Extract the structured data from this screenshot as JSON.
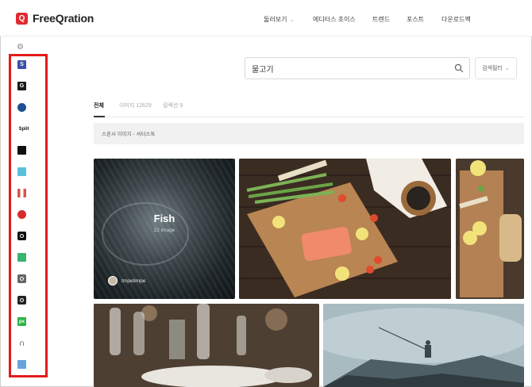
{
  "app": {
    "logo_mark": "Q",
    "name": "FreeQration"
  },
  "nav": {
    "items": [
      {
        "label": "둘러보기",
        "has_chevron": true
      },
      {
        "label": "에디터스 초이스"
      },
      {
        "label": "트렌드"
      },
      {
        "label": "포스트"
      },
      {
        "label": "다운로드팩"
      }
    ],
    "chevron": "⌄"
  },
  "sidebar": {
    "gear_icon": "gear-icon",
    "items": [
      {
        "icon": "shutterstock-icon",
        "glyph": "S",
        "color": "#3c4fa8"
      },
      {
        "icon": "getty-icon",
        "glyph": "G",
        "color": "#1a1a1a"
      },
      {
        "icon": "circle-logo-icon",
        "glyph": "●",
        "color": "#1d4f91"
      },
      {
        "icon": "split-icon",
        "glyph": "Split",
        "color": "#ffffff"
      },
      {
        "icon": "black-square-icon",
        "glyph": "▪",
        "color": "#111111"
      },
      {
        "icon": "cloud-icon",
        "glyph": "☁",
        "color": "#5bc0de"
      },
      {
        "icon": "flag-icon",
        "glyph": "⚑",
        "color": "#d9534f"
      },
      {
        "icon": "strawberry-icon",
        "glyph": "●",
        "color": "#d62b2b"
      },
      {
        "icon": "camera-icon",
        "glyph": "◉",
        "color": "#111111"
      },
      {
        "icon": "green-grid-icon",
        "glyph": "▦",
        "color": "#3cb371"
      },
      {
        "icon": "camera-grey-icon",
        "glyph": "◎",
        "color": "#666666"
      },
      {
        "icon": "camera-dark-icon",
        "glyph": "◉",
        "color": "#222222"
      },
      {
        "icon": "px-icon",
        "glyph": "px",
        "color": "#2fb34a"
      },
      {
        "icon": "arch-icon",
        "glyph": "∩",
        "color": "#222222"
      },
      {
        "icon": "picture-icon",
        "glyph": "▲",
        "color": "#6aa3d8"
      }
    ]
  },
  "search": {
    "value": "물고기",
    "filter_label": "검색필터"
  },
  "tabs": [
    {
      "label": "전체",
      "active": true
    },
    {
      "label": "이미지 12629",
      "active": false
    },
    {
      "label": "컬렉션 9",
      "active": false
    }
  ],
  "sponsor": {
    "text": "스폰서 이미지 - 셔터스톡"
  },
  "results": {
    "featured": {
      "title": "Fish",
      "subtitle": "22 image",
      "username": "tmpetimpe"
    }
  }
}
